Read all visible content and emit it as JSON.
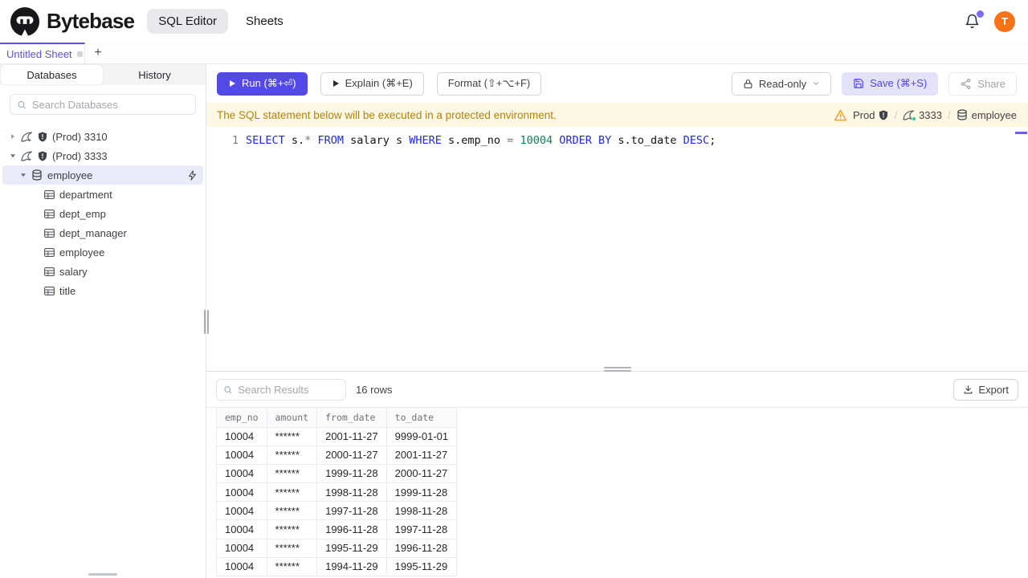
{
  "app": {
    "brand": "Bytebase",
    "nav": [
      {
        "label": "SQL Editor",
        "active": true
      },
      {
        "label": "Sheets",
        "active": false
      }
    ],
    "avatar_initial": "T"
  },
  "sheet_tabs": {
    "active_tab": "Untitled Sheet",
    "new_tab_label": "+"
  },
  "sidebar": {
    "tabs": [
      {
        "label": "Databases",
        "active": true
      },
      {
        "label": "History",
        "active": false
      }
    ],
    "search_placeholder": "Search Databases",
    "tree": [
      {
        "type": "instance",
        "label": "(Prod) 3310",
        "expanded": false
      },
      {
        "type": "instance",
        "label": "(Prod) 3333",
        "expanded": true
      },
      {
        "type": "database",
        "label": "employee",
        "selected": true
      },
      {
        "type": "table",
        "label": "department"
      },
      {
        "type": "table",
        "label": "dept_emp"
      },
      {
        "type": "table",
        "label": "dept_manager"
      },
      {
        "type": "table",
        "label": "employee"
      },
      {
        "type": "table",
        "label": "salary"
      },
      {
        "type": "table",
        "label": "title"
      }
    ]
  },
  "toolbar": {
    "run_label": "Run (⌘+⏎)",
    "explain_label": "Explain (⌘+E)",
    "format_label": "Format (⇧+⌥+F)",
    "readonly_label": "Read-only",
    "save_label": "Save (⌘+S)",
    "share_label": "Share"
  },
  "banner": {
    "message": "The SQL statement below will be executed in a protected environment.",
    "environment": "Prod",
    "instance": "3333",
    "database": "employee",
    "separator": "/"
  },
  "editor": {
    "line_number": "1",
    "code_tokens": [
      {
        "text": "SELECT",
        "type": "keyword"
      },
      {
        "text": " s.",
        "type": "plain"
      },
      {
        "text": "*",
        "type": "operator"
      },
      {
        "text": " ",
        "type": "plain"
      },
      {
        "text": "FROM",
        "type": "keyword"
      },
      {
        "text": " salary s ",
        "type": "plain"
      },
      {
        "text": "WHERE",
        "type": "keyword"
      },
      {
        "text": " s.emp_no ",
        "type": "plain"
      },
      {
        "text": "=",
        "type": "operator"
      },
      {
        "text": " ",
        "type": "plain"
      },
      {
        "text": "10004",
        "type": "number"
      },
      {
        "text": " ",
        "type": "plain"
      },
      {
        "text": "ORDER BY",
        "type": "keyword"
      },
      {
        "text": " s.to_date ",
        "type": "plain"
      },
      {
        "text": "DESC",
        "type": "keyword"
      },
      {
        "text": ";",
        "type": "plain"
      }
    ]
  },
  "results": {
    "search_placeholder": "Search Results",
    "row_count_label": "16 rows",
    "export_label": "Export",
    "table": {
      "columns": [
        "emp_no",
        "amount",
        "from_date",
        "to_date"
      ],
      "rows": [
        [
          "10004",
          "******",
          "2001-11-27",
          "9999-01-01"
        ],
        [
          "10004",
          "******",
          "2000-11-27",
          "2001-11-27"
        ],
        [
          "10004",
          "******",
          "1999-11-28",
          "2000-11-27"
        ],
        [
          "10004",
          "******",
          "1998-11-28",
          "1999-11-28"
        ],
        [
          "10004",
          "******",
          "1997-11-28",
          "1998-11-28"
        ],
        [
          "10004",
          "******",
          "1996-11-28",
          "1997-11-28"
        ],
        [
          "10004",
          "******",
          "1995-11-29",
          "1996-11-28"
        ],
        [
          "10004",
          "******",
          "1994-11-29",
          "1995-11-29"
        ]
      ]
    }
  },
  "icons": {
    "logo": "bytebase-logo",
    "bell": "notification-bell",
    "search": "magnifier",
    "instance": "mysql-dolphin",
    "protection": "shield",
    "database": "cylinder",
    "table": "grid",
    "sql_mode": "lightning-bolt",
    "run": "play-triangle",
    "readonly": "padlock",
    "save": "floppy-disk",
    "share": "share-nodes",
    "export": "download-tray",
    "warning": "warning-triangle"
  },
  "colors": {
    "accent": "#5349e7",
    "avatar_bg": "#f97316",
    "banner_bg": "#fcf8e3",
    "banner_text": "#b5820f",
    "keyword": "#202ae6",
    "number": "#098658",
    "selected_tree_row_bg": "#e9ebf8",
    "save_button_bg": "#e4e2fa"
  }
}
